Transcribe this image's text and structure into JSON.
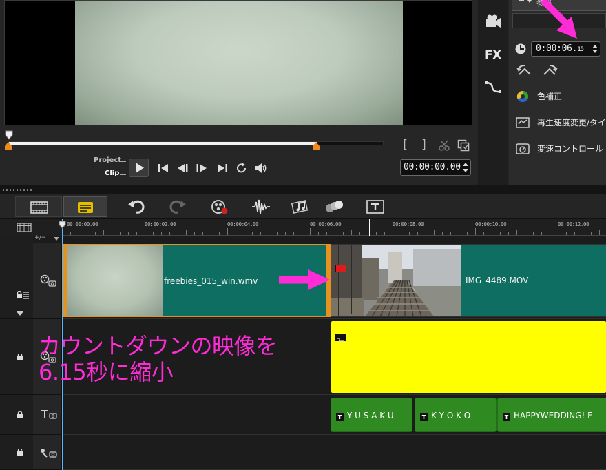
{
  "preview": {
    "mode_project": "Project",
    "mode_clip": "Clip",
    "mark_in": "[",
    "mark_out": "]",
    "clip_timecode": "00:00:00.00",
    "scrub_position": 0.82
  },
  "options": {
    "tab_label": "参照",
    "fx_label": "FX",
    "duration": "0:00:06.",
    "duration_frames": "15",
    "color_correction": "色補正",
    "speed_change": "再生速度変更/タイム",
    "variable_speed": "変速コントロール"
  },
  "timeline": {
    "track_ctrl": "+/−",
    "ruler_ticks": [
      "00:00:00.00",
      "00:00:02.00",
      "00:00:04.00",
      "00:00:06.00",
      "00:00:08.00",
      "00:00:10.00",
      "00:00:12.00"
    ],
    "video_clips": [
      {
        "label": "freebies_015_win.wmv"
      },
      {
        "label": "IMG_4489.MOV"
      }
    ],
    "title_clips": [
      {
        "label": "Y U S A K U"
      },
      {
        "label": "K Y O K O"
      },
      {
        "label": "HAPPYWEDDING!   F"
      }
    ]
  },
  "annotation": {
    "text": "カウントダウンの映像を\n6.15秒に縮小",
    "color": "#ff2bd6"
  },
  "colors": {
    "clip_teal": "#0f6e62",
    "overlay_yellow": "#ffff00",
    "title_green": "#2f8a21",
    "trim_orange": "#e6921e"
  }
}
